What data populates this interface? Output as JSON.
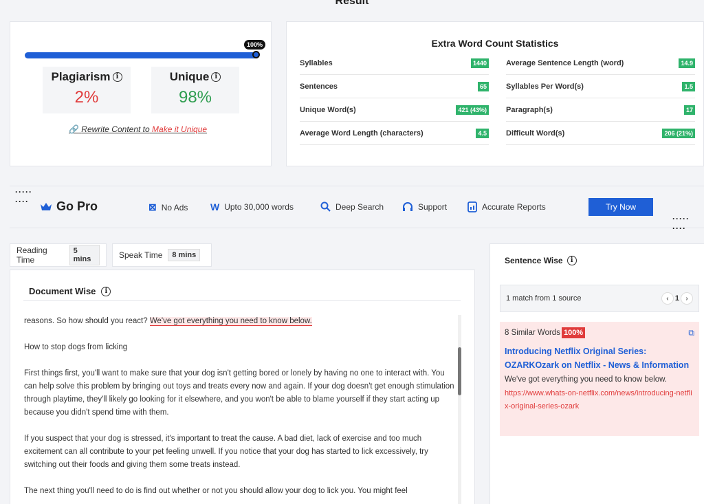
{
  "result": {
    "title": "Result"
  },
  "score": {
    "progress_label": "100%",
    "progress_fraction": 1.0,
    "plagiarism_label": "Plagiarism",
    "plagiarism_value": "2%",
    "unique_label": "Unique",
    "unique_value": "98%",
    "rewrite_text": "Rewrite Content to",
    "rewrite_link": "Make it Unique",
    "colors": {
      "plagiarism": "#e03b3b",
      "unique": "#2e9d4f",
      "progress": "#1f5fd6"
    }
  },
  "stats": {
    "title": "Extra Word Count Statistics",
    "left": [
      {
        "label": "Syllables",
        "value": "1440"
      },
      {
        "label": "Sentences",
        "value": "65"
      },
      {
        "label": "Unique Word(s)",
        "value": "421 (43%)"
      },
      {
        "label": "Average Word Length (characters)",
        "value": "4.5"
      }
    ],
    "right": [
      {
        "label": "Average Sentence Length (word)",
        "value": "14.9"
      },
      {
        "label": "Syllables Per Word(s)",
        "value": "1.5"
      },
      {
        "label": "Paragraph(s)",
        "value": "17"
      },
      {
        "label": "Difficult Word(s)",
        "value": "206 (21%)"
      }
    ],
    "badge_color": "#2fb36b"
  },
  "gopro": {
    "title": "Go Pro",
    "features": [
      {
        "icon": "ad-block-icon",
        "label": "No Ads"
      },
      {
        "icon": "word-icon",
        "label": "Upto 30,000 words"
      },
      {
        "icon": "search-icon",
        "label": "Deep Search"
      },
      {
        "icon": "headphones-icon",
        "label": "Support"
      },
      {
        "icon": "report-icon",
        "label": "Accurate Reports"
      }
    ],
    "button": "Try Now"
  },
  "times": {
    "reading_label": "Reading Time",
    "reading_value": "5 mins",
    "speak_label": "Speak Time",
    "speak_value": "8 mins"
  },
  "document": {
    "title": "Document Wise",
    "line1_plain": "reasons. So how should you react? ",
    "line1_highlight": "We've got everything you need to know below.",
    "paragraphs": [
      "How to stop dogs from licking",
      "First things first, you'll want to make sure that your dog isn't getting bored or lonely by having no one to interact with. You can help solve this problem by bringing out toys and treats every now and again. If your dog doesn't get enough stimulation through playtime, they'll likely go looking for it elsewhere, and you won't be able to blame yourself if they start acting up because you didn't spend time with them.",
      "If you suspect that your dog is stressed, it's important to treat the cause. A bad diet, lack of exercise and too much excitement can all contribute to your pet feeling unwell. If you notice that your dog has started to lick excessively, try switching out their foods and giving them some treats instead.",
      "The next thing you'll need to do is find out whether or not you should allow your dog to lick you. You might feel"
    ]
  },
  "sentence_wise": {
    "title": "Sentence Wise",
    "match_text": "1 match from 1 source",
    "page": "1",
    "similar_label": "8 Similar Words",
    "similar_pct": "100%",
    "source_title": "Introducing Netflix Original Series: OZARKOzark on Netflix - News & Information",
    "source_text": "We've got everything you need to know below.",
    "source_url": "https://www.whats-on-netflix.com/news/introducing-netflix-original-series-ozark"
  }
}
